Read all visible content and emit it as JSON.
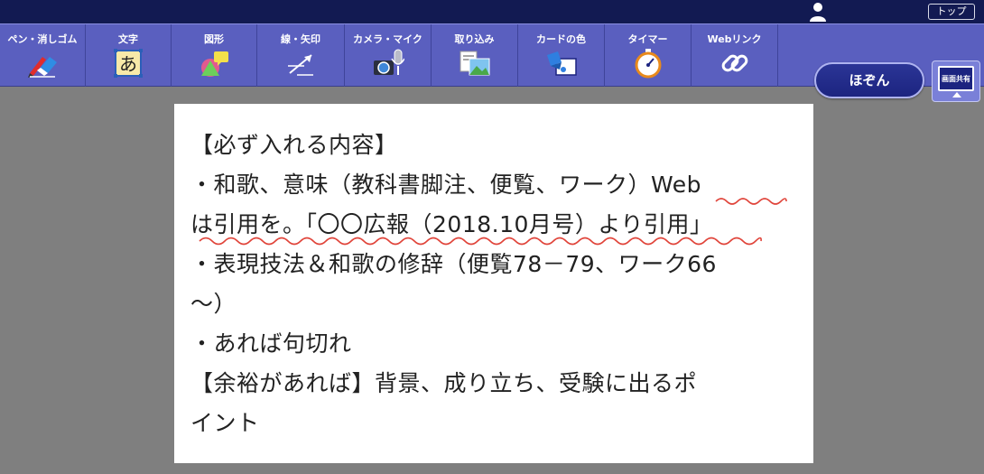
{
  "header": {
    "top_label": "トップ",
    "user_icon": "user-icon"
  },
  "toolbar": {
    "tools": [
      {
        "label": "ペン・消しゴム",
        "icon": "pen-eraser-icon"
      },
      {
        "label": "文字",
        "icon": "text-icon",
        "glyph": "あ"
      },
      {
        "label": "図形",
        "icon": "shape-icon"
      },
      {
        "label": "線・矢印",
        "icon": "line-arrow-icon"
      },
      {
        "label": "カメラ・マイク",
        "icon": "camera-mic-icon"
      },
      {
        "label": "取り込み",
        "icon": "import-icon"
      },
      {
        "label": "カードの色",
        "icon": "card-color-icon"
      },
      {
        "label": "タイマー",
        "icon": "timer-icon"
      },
      {
        "label": "Webリンク",
        "icon": "web-link-icon"
      }
    ],
    "save_label": "ほぞん",
    "share_label": "画面共有"
  },
  "card": {
    "lines": [
      "【必ず入れる内容】",
      "・和歌、意味（教科書脚注、便覧、ワーク）Web",
      "は引用を。「〇〇広報（2018.10月号）より引用」",
      "・表現技法＆和歌の修辞（便覧78－79、ワーク66",
      "～）",
      "・あれば句切れ",
      "【余裕があれば】背景、成り立ち、受験に出るポ",
      "イント"
    ],
    "annotation_color": "#e0443a"
  },
  "colors": {
    "topbar": "#121a52",
    "toolbar": "#5a5fbf",
    "background": "#7f7f7f",
    "save_button": "#1c2480"
  }
}
